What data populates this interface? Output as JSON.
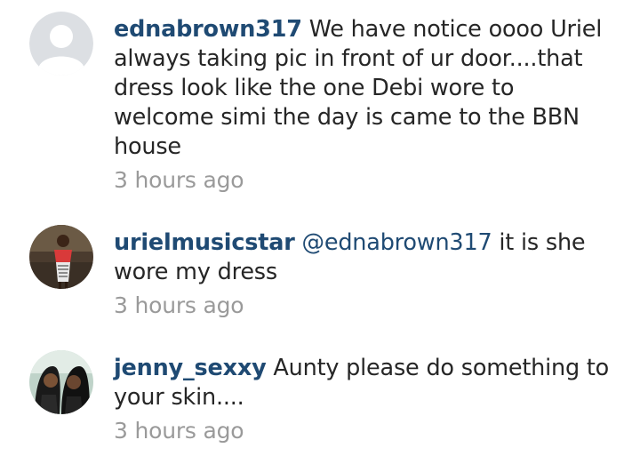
{
  "comments": [
    {
      "username": "ednabrown317",
      "text": "We have notice oooo Uriel always taking pic in front of ur door....that dress look like the one Debi wore to welcome simi the day is came to the BBN house",
      "time": "3 hours ago",
      "avatar": "default-avatar-icon"
    },
    {
      "username": "urielmusicstar",
      "mention": "@ednabrown317",
      "text": " it is she wore my dress",
      "time": "3 hours ago",
      "avatar": "user-photo"
    },
    {
      "username": "jenny_sexxy",
      "text": "Aunty please do something to your skin....",
      "time": "3 hours ago",
      "avatar": "user-photo"
    }
  ],
  "colors": {
    "username": "#1f4a73",
    "text": "#262626",
    "time": "#9a9a9a",
    "placeholder_bg": "#dcdfe3",
    "placeholder_fg": "#ffffff"
  }
}
